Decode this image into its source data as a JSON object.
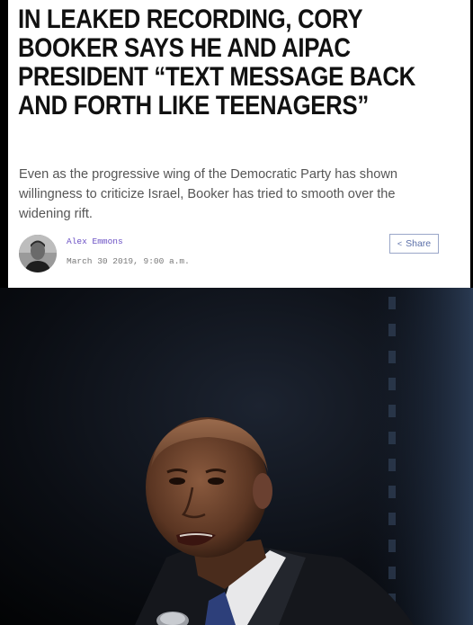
{
  "article": {
    "headline": "IN LEAKED RECORDING, CORY BOOKER SAYS HE AND AIPAC PRESIDENT “TEXT MESSAGE BACK AND FORTH LIKE TEENAGERS”",
    "dek": "Even as the progressive wing of the Democratic Party has shown willingness to criticize Israel, Booker has tried to smooth over the widening rift.",
    "author": "Alex Emmons",
    "date": "March 30 2019, 9:00 a.m.",
    "share_label": "Share",
    "share_icon": "share-icon"
  },
  "colors": {
    "author_link": "#6a4fc4",
    "share_accent": "#5b6fa8",
    "background": "#000000"
  }
}
